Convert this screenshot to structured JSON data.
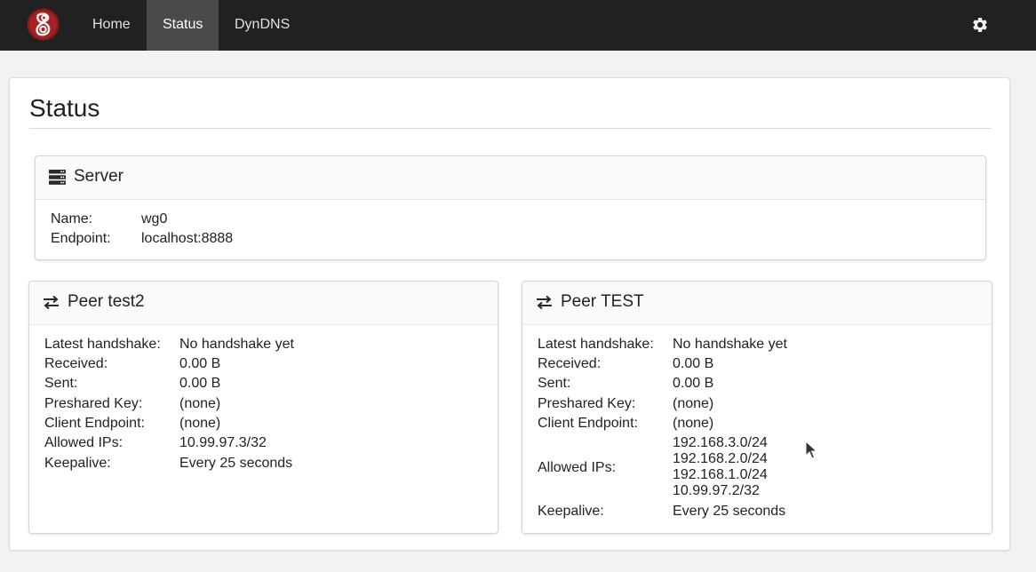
{
  "nav": {
    "logo_icon": "wireguard-logo-icon",
    "items": [
      {
        "label": "Home",
        "active": false
      },
      {
        "label": "Status",
        "active": true
      },
      {
        "label": "DynDNS",
        "active": false
      }
    ],
    "settings_icon": "gear-icon"
  },
  "page": {
    "title": "Status"
  },
  "server": {
    "icon": "server-icon",
    "title": "Server",
    "fields": [
      {
        "label": "Name:",
        "value": "wg0"
      },
      {
        "label": "Endpoint:",
        "value": "localhost:8888"
      }
    ]
  },
  "peers": [
    {
      "icon": "exchange-icon",
      "title": "Peer test2",
      "fields": [
        {
          "label": "Latest handshake:",
          "value": "No handshake yet"
        },
        {
          "label": "Received:",
          "value": "0.00 B"
        },
        {
          "label": "Sent:",
          "value": "0.00 B"
        },
        {
          "label": "Preshared Key:",
          "value": "(none)"
        },
        {
          "label": "Client Endpoint:",
          "value": "(none)"
        },
        {
          "label": "Allowed IPs:",
          "value": "10.99.97.3/32"
        },
        {
          "label": "Keepalive:",
          "value": "Every 25 seconds"
        }
      ]
    },
    {
      "icon": "exchange-icon",
      "title": "Peer TEST",
      "fields": [
        {
          "label": "Latest handshake:",
          "value": "No handshake yet"
        },
        {
          "label": "Received:",
          "value": "0.00 B"
        },
        {
          "label": "Sent:",
          "value": "0.00 B"
        },
        {
          "label": "Preshared Key:",
          "value": "(none)"
        },
        {
          "label": "Client Endpoint:",
          "value": "(none)"
        }
      ],
      "allowed_ips_label": "Allowed IPs:",
      "allowed_ips": [
        "192.168.3.0/24",
        "192.168.2.0/24",
        "192.168.1.0/24",
        "10.99.97.2/32"
      ],
      "keepalive_label": "Keepalive:",
      "keepalive_value": "Every 25 seconds"
    }
  ],
  "colors": {
    "navbar_bg": "#212121",
    "nav_active_bg": "#4a4a4a",
    "logo_red": "#8b1a1a",
    "page_bg": "#f2f2f2"
  }
}
